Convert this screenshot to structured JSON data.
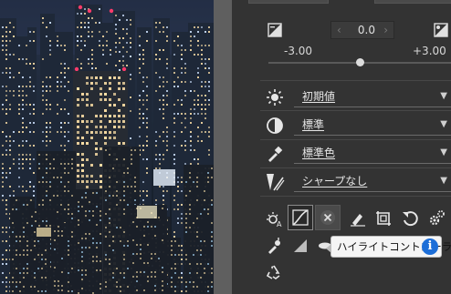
{
  "exposure": {
    "value": "0.0",
    "min_label": "-3.00",
    "max_label": "+3.00",
    "level": 0.5
  },
  "rows": [
    {
      "icon": "brightness-sun-icon",
      "label": "初期値"
    },
    {
      "icon": "contrast-icon",
      "label": "標準"
    },
    {
      "icon": "eyedropper-color-icon",
      "label": "標準色"
    },
    {
      "icon": "sharpness-icon",
      "label": "シャープなし"
    }
  ],
  "tooltip": {
    "text": "ハイライトコントローラ",
    "info_glyph": "i"
  },
  "colors": {
    "panel": "#333333",
    "accent_info": "#1c6ed8",
    "selected_tool_border": "#8a8a8a"
  }
}
